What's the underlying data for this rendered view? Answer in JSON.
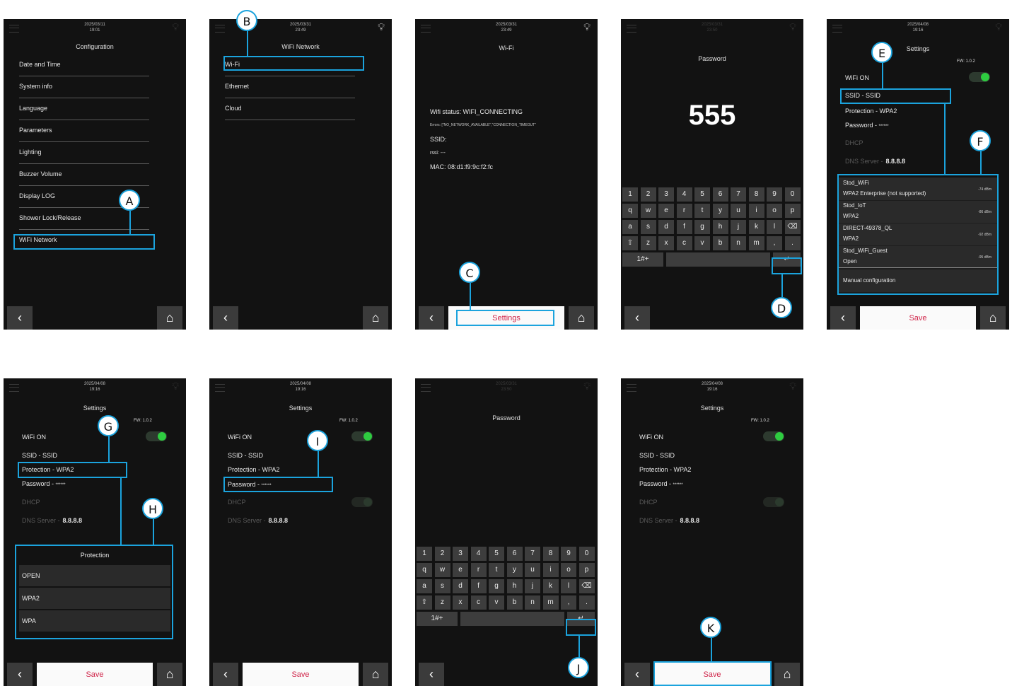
{
  "accent_color": "#1ba3dd",
  "save_color": "#d0254a",
  "toggle_on_color": "#2ecc40",
  "icons": {
    "back": "chevron-left-icon",
    "home": "home-icon",
    "bulb": "bulb-icon",
    "menu": "hamburger-icon",
    "enter": "enter-icon",
    "backspace": "backspace-icon",
    "shift": "shift-icon"
  },
  "screen1": {
    "date": "2025/03/11",
    "time": "19:01",
    "title": "Configuration",
    "items": [
      "Date and Time",
      "System info",
      "Language",
      "Parameters",
      "Lighting",
      "Buzzer Volume",
      "Display LOG",
      "Shower Lock/Release",
      "WiFi Network"
    ],
    "badge": "A"
  },
  "screen2": {
    "date": "2025/03/31",
    "time": "23:49",
    "title": "WiFi Network",
    "items": [
      "Wi-Fi",
      "Ethernet",
      "Cloud"
    ],
    "badge": "B"
  },
  "screen3": {
    "date": "2025/03/31",
    "time": "23:49",
    "title": "Wi-Fi",
    "status": "Wifi status: WIFI_CONNECTING",
    "errors": "Errors: [\"NO_NETWORK_AVAILABLE\",\"CONNECTION_TIMEOUT\"",
    "ssid": "SSID:",
    "rssi": "rssi: ---",
    "mac": "MAC: 08:d1:f9:9c:f2:fc",
    "settings_label": "Settings",
    "badge": "C"
  },
  "screen4": {
    "date": "2025/03/31",
    "time": "23:50",
    "title": "Password",
    "value": "555",
    "badge": "D"
  },
  "keyboard": {
    "row1": [
      "1",
      "2",
      "3",
      "4",
      "5",
      "6",
      "7",
      "8",
      "9",
      "0"
    ],
    "row2": [
      "q",
      "w",
      "e",
      "r",
      "t",
      "y",
      "u",
      "i",
      "o",
      "p"
    ],
    "row3": [
      "a",
      "s",
      "d",
      "f",
      "g",
      "h",
      "j",
      "k",
      "l",
      "⌫"
    ],
    "row4": [
      "⇧",
      "z",
      "x",
      "c",
      "v",
      "b",
      "n",
      "m",
      ",",
      "."
    ],
    "mode_key": "1#+",
    "enter_key": "↵"
  },
  "settings": {
    "date": "2025/04/08",
    "time": "19:16",
    "title": "Settings",
    "fw": "FW: 1.0.2",
    "wifi_on": "WiFi ON",
    "ssid_label": "SSID -",
    "ssid_value": "SSID",
    "protection_label": "Protection -",
    "protection_value": "WPA2",
    "password_label": "Password -",
    "password_value": "******",
    "dhcp": "DHCP",
    "dns_label": "DNS Server -",
    "dns_value": "8.8.8.8",
    "save_label": "Save"
  },
  "screen5": {
    "badge_e": "E",
    "badge_f": "F",
    "networks": [
      {
        "name": "Stod_WiFi",
        "security": "WPA2 Enterprise (not supported)",
        "rssi": "-74 dBm"
      },
      {
        "name": "Stod_IoT",
        "security": "WPA2",
        "rssi": "-86 dBm"
      },
      {
        "name": "DIRECT-49378_QL",
        "security": "WPA2",
        "rssi": "-92 dBm"
      },
      {
        "name": "Stod_WiFi_Guest",
        "security": "Open",
        "rssi": "-95 dBm"
      }
    ],
    "manual": "Manual configuration"
  },
  "screen6": {
    "badge_g": "G",
    "badge_h": "H",
    "protection_title": "Protection",
    "options": [
      "OPEN",
      "WPA2",
      "WPA"
    ]
  },
  "screen7": {
    "badge": "I"
  },
  "screen8": {
    "date": "2025/03/31",
    "time": "23:50",
    "title": "Password",
    "badge": "J"
  },
  "screen9": {
    "badge": "K"
  }
}
